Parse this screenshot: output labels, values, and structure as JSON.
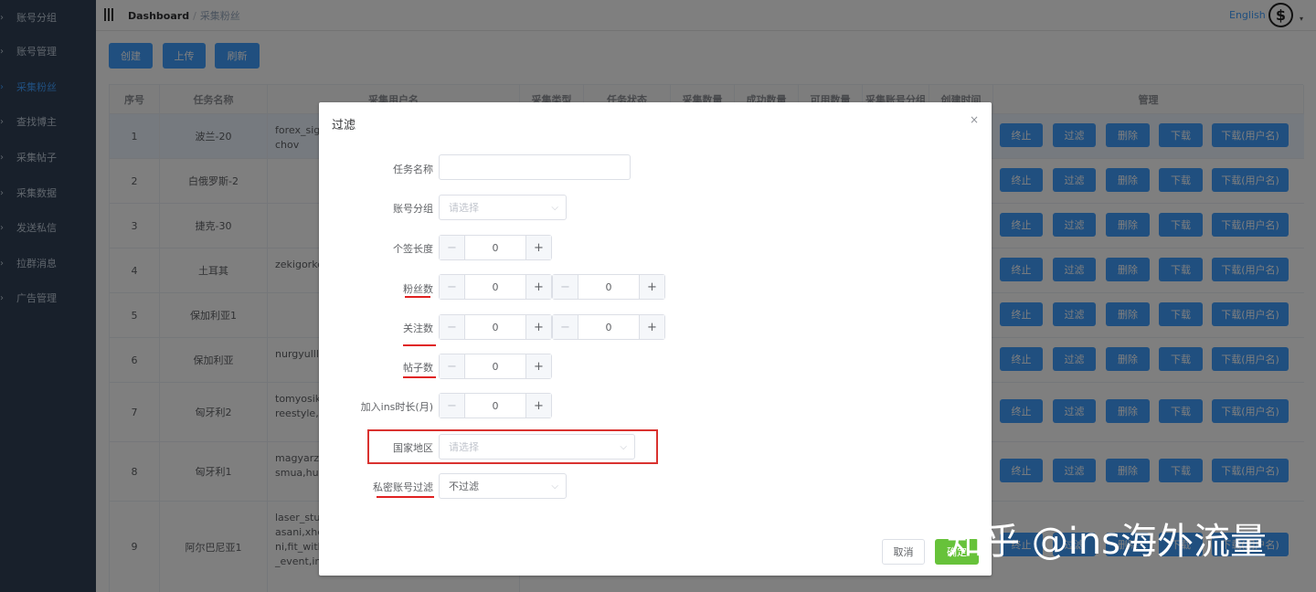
{
  "sidebar": {
    "items": [
      {
        "label": "账号分组",
        "active": false
      },
      {
        "label": "账号管理",
        "active": false
      },
      {
        "label": "采集粉丝",
        "active": true
      },
      {
        "label": "查找博主",
        "active": false
      },
      {
        "label": "采集帖子",
        "active": false
      },
      {
        "label": "采集数据",
        "active": false
      },
      {
        "label": "发送私信",
        "active": false
      },
      {
        "label": "拉群消息",
        "active": false
      },
      {
        "label": "广告管理",
        "active": false
      }
    ]
  },
  "header": {
    "breadcrumb": [
      "Dashboard",
      "采集粉丝"
    ],
    "separator": "/",
    "language": "English",
    "avatar_glyph": "$",
    "caret": "▾"
  },
  "toolbar": {
    "create_label": "创建",
    "upload_label": "上传",
    "refresh_label": "刷新"
  },
  "table": {
    "columns": [
      "序号",
      "任务名称",
      "采集用户名",
      "采集类型",
      "任务状态",
      "采集数量",
      "成功数量",
      "可用数量",
      "采集账号分组",
      "创建时间",
      "管理"
    ],
    "rows": [
      {
        "index": "1",
        "name": "波兰-20",
        "usernames": "forex_signa\nchov"
      },
      {
        "index": "2",
        "name": "白俄罗斯-2",
        "usernames": ""
      },
      {
        "index": "3",
        "name": "捷克-30",
        "usernames": ""
      },
      {
        "index": "4",
        "name": "土耳其",
        "usernames": "zekigorkem"
      },
      {
        "index": "5",
        "name": "保加利亚1",
        "usernames": ""
      },
      {
        "index": "6",
        "name": "保加利亚",
        "usernames": "nurgyulll,ev"
      },
      {
        "index": "7",
        "name": "匈牙利2",
        "usernames": "tomyosikris\nreestyle,va"
      },
      {
        "index": "8",
        "name": "匈牙利1",
        "usernames": "magyarzen\nsmua,hunb"
      },
      {
        "index": "9",
        "name": "阿尔巴尼亚1",
        "usernames": "laser_stud\nasani,xhedi\nni,fit_withkl\n_event,intim"
      }
    ],
    "actions": [
      "终止",
      "过滤",
      "删除",
      "下载",
      "下载(用户名)"
    ]
  },
  "dialog": {
    "title": "过滤",
    "close": "×",
    "fields": {
      "task_name_label": "任务名称",
      "task_name_value": "",
      "group_label": "账号分组",
      "group_placeholder": "请选择",
      "bio_len_label": "个签长度",
      "bio_len_value": "0",
      "followers_label": "粉丝数",
      "followers_min": "0",
      "followers_max": "0",
      "following_label": "关注数",
      "following_min": "0",
      "following_max": "0",
      "posts_label": "帖子数",
      "posts_value": "0",
      "join_label": "加入ins时长(月)",
      "join_value": "0",
      "country_label": "国家地区",
      "country_placeholder": "请选择",
      "private_label": "私密账号过滤",
      "private_value": "不过滤"
    },
    "cancel_label": "取消",
    "confirm_label": "确定",
    "minus_glyph": "−",
    "plus_glyph": "+",
    "chevron_glyph": "⌵"
  },
  "watermark": "知乎 @ins海外流量",
  "colors": {
    "sidebar_bg": "#304156",
    "primary": "#409eff",
    "confirm": "#67c23a",
    "highlight_red": "#d9322f"
  }
}
